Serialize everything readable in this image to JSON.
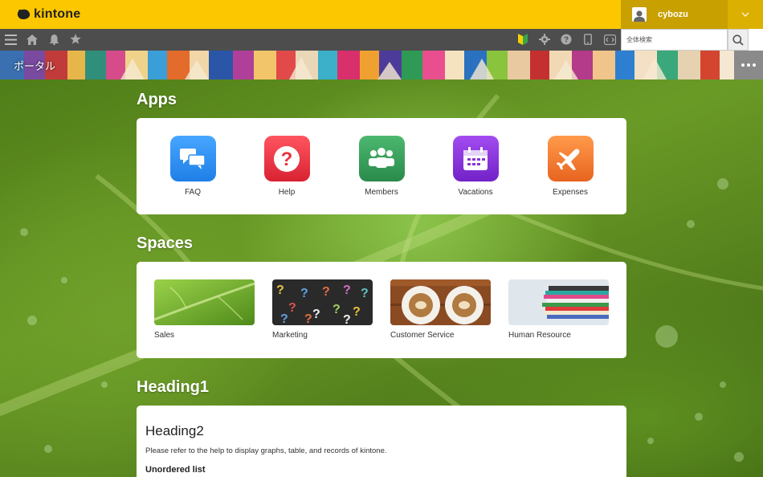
{
  "header": {
    "logo_text": "kintone",
    "user_name": "cybozu",
    "brand_color": "#fdc700"
  },
  "navbar": {
    "icons": [
      "menu-icon",
      "home-icon",
      "bell-icon",
      "star-icon",
      "beginner-mark-icon",
      "gear-icon",
      "help-icon",
      "mobile-icon",
      "code-icon"
    ],
    "search_placeholder": "全体検索"
  },
  "banner": {
    "title": "ポータル"
  },
  "apps": {
    "heading": "Apps",
    "items": [
      {
        "label": "FAQ",
        "icon": "chat-bubbles-icon",
        "color": "#2d8ff0"
      },
      {
        "label": "Help",
        "icon": "question-icon",
        "color": "#e8323f"
      },
      {
        "label": "Members",
        "icon": "people-icon",
        "color": "#35a05a"
      },
      {
        "label": "Vacations",
        "icon": "calendar-icon",
        "color": "#8a32d8"
      },
      {
        "label": "Expenses",
        "icon": "airplane-icon",
        "color": "#f07830"
      }
    ]
  },
  "spaces": {
    "heading": "Spaces",
    "items": [
      {
        "label": "Sales"
      },
      {
        "label": "Marketing"
      },
      {
        "label": "Customer Service"
      },
      {
        "label": "Human Resource"
      }
    ]
  },
  "content": {
    "heading1": "Heading1",
    "heading2": "Heading2",
    "description": "Please refer to the help to display graphs, table, and records of kintone.",
    "list_heading": "Unordered list"
  }
}
